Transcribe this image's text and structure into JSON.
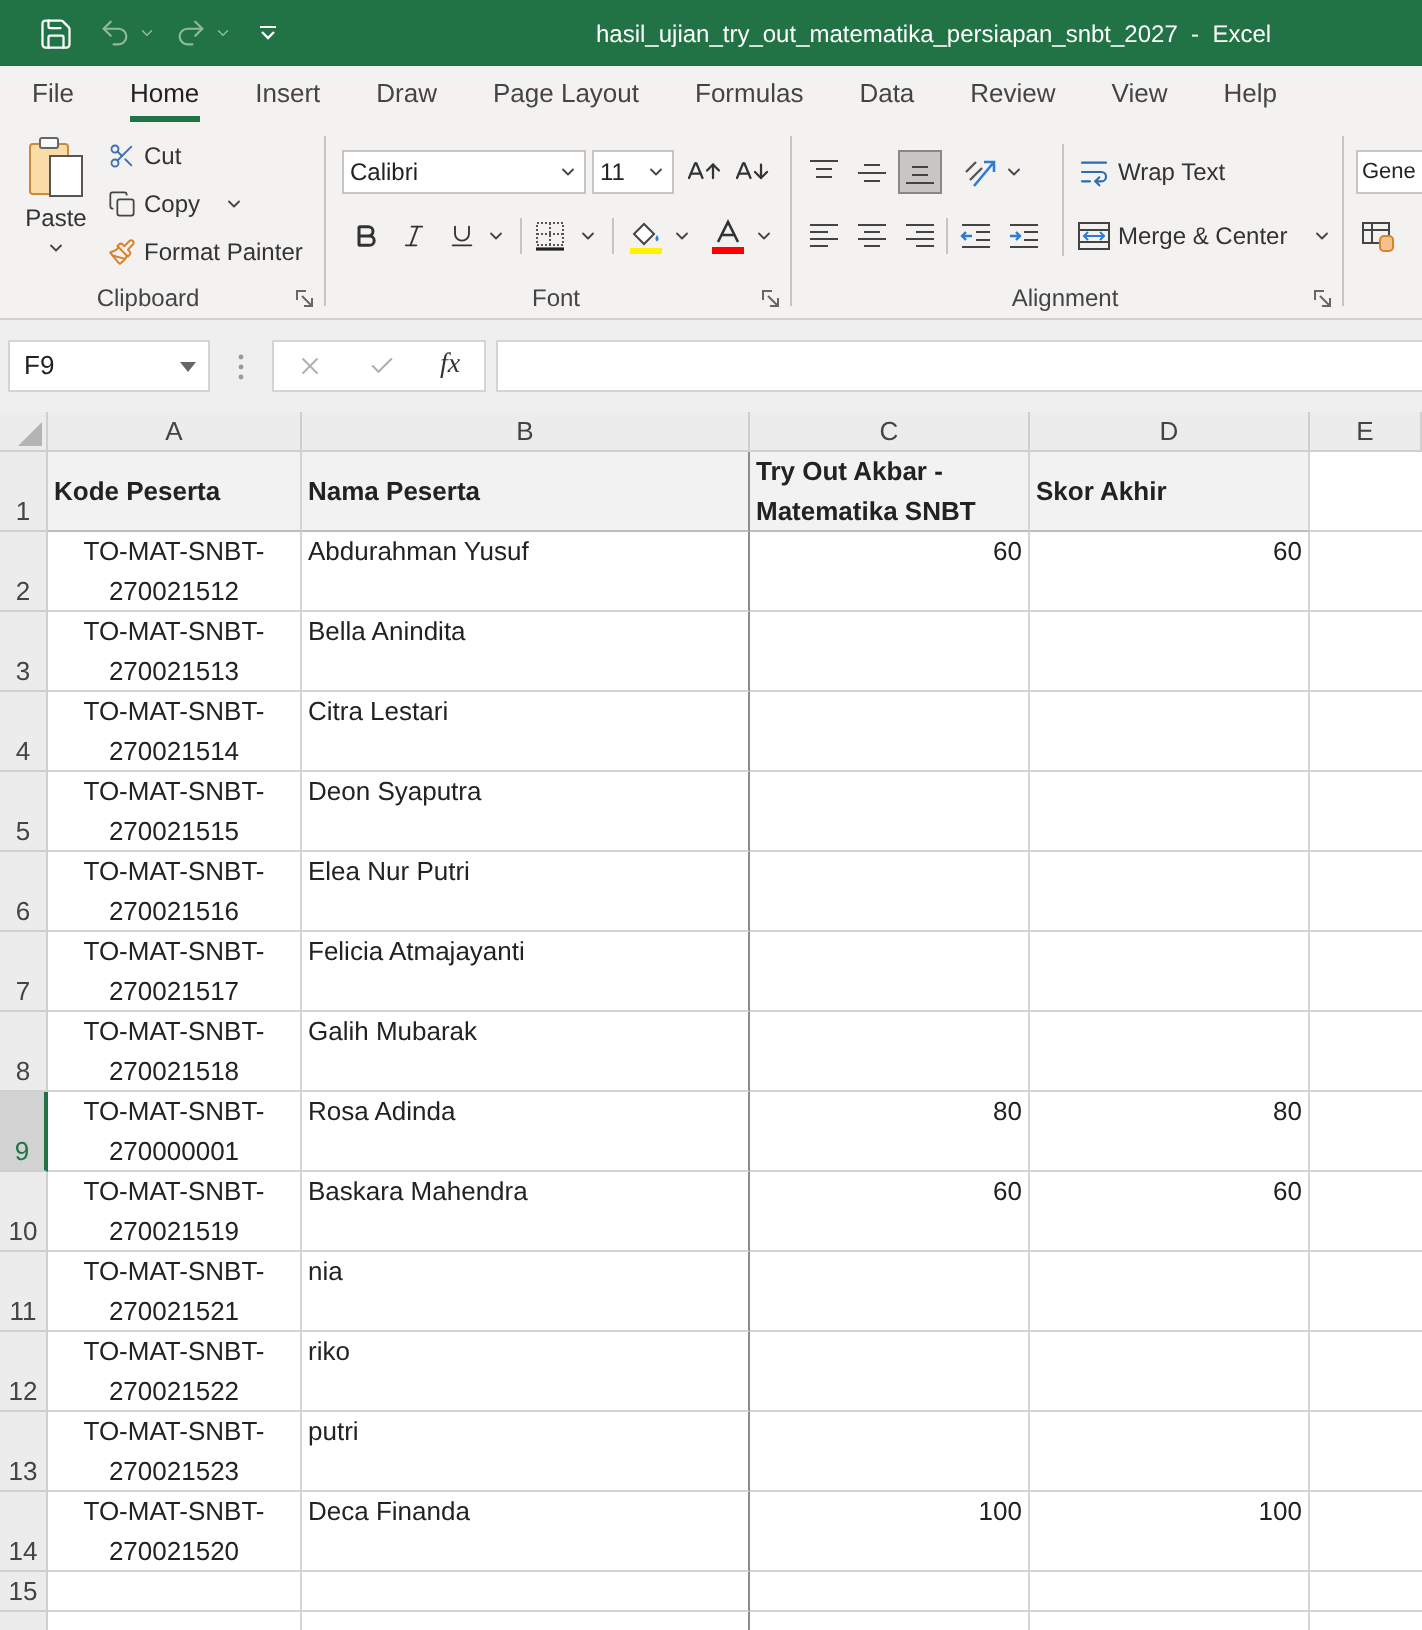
{
  "window": {
    "title": "hasil_ujian_try_out_matematika_persiapan_snbt_2027  -  Excel"
  },
  "menu_tabs": [
    {
      "label": "File",
      "selected": false
    },
    {
      "label": "Home",
      "selected": true
    },
    {
      "label": "Insert",
      "selected": false
    },
    {
      "label": "Draw",
      "selected": false
    },
    {
      "label": "Page Layout",
      "selected": false
    },
    {
      "label": "Formulas",
      "selected": false
    },
    {
      "label": "Data",
      "selected": false
    },
    {
      "label": "Review",
      "selected": false
    },
    {
      "label": "View",
      "selected": false
    },
    {
      "label": "Help",
      "selected": false
    }
  ],
  "ribbon": {
    "clipboard": {
      "paste": "Paste",
      "cut": "Cut",
      "copy": "Copy",
      "format_painter": "Format Painter",
      "label": "Clipboard"
    },
    "font": {
      "font_name": "Calibri",
      "font_size": "11",
      "label": "Font"
    },
    "alignment": {
      "vertical": [
        {
          "kind": "top",
          "selected": false
        },
        {
          "kind": "middle",
          "selected": false
        },
        {
          "kind": "bottom",
          "selected": true
        }
      ],
      "horizontal": [
        {
          "kind": "left",
          "selected": false
        },
        {
          "kind": "center",
          "selected": false
        },
        {
          "kind": "right",
          "selected": false
        }
      ],
      "wrap_text": "Wrap Text",
      "merge_center": "Merge & Center",
      "label": "Alignment"
    },
    "number": {
      "format": "Gene"
    }
  },
  "formula_bar": {
    "name_box": "F9",
    "function_button": "fx"
  },
  "sheet": {
    "columns": [
      {
        "label": "A",
        "selected": false
      },
      {
        "label": "B",
        "selected": false
      },
      {
        "label": "C",
        "selected": false
      },
      {
        "label": "D",
        "selected": false
      },
      {
        "label": "E",
        "selected": false
      }
    ],
    "header_row": {
      "number": "1",
      "selected": false,
      "cells": [
        "Kode Peserta",
        "Nama Peserta",
        "Try Out Akbar - Matematika SNBT",
        "Skor Akhir"
      ]
    },
    "rows": [
      {
        "number": "2",
        "selected": false,
        "kode_peserta": "TO-MAT-SNBT-270021512",
        "nama_peserta": "Abdurahman Yusuf",
        "try_out_akbar": "60",
        "skor_akhir": "60"
      },
      {
        "number": "3",
        "selected": false,
        "kode_peserta": "TO-MAT-SNBT-270021513",
        "nama_peserta": "Bella Anindita"
      },
      {
        "number": "4",
        "selected": false,
        "kode_peserta": "TO-MAT-SNBT-270021514",
        "nama_peserta": "Citra Lestari"
      },
      {
        "number": "5",
        "selected": false,
        "kode_peserta": "TO-MAT-SNBT-270021515",
        "nama_peserta": "Deon Syaputra"
      },
      {
        "number": "6",
        "selected": false,
        "kode_peserta": "TO-MAT-SNBT-270021516",
        "nama_peserta": "Elea Nur Putri"
      },
      {
        "number": "7",
        "selected": false,
        "kode_peserta": "TO-MAT-SNBT-270021517",
        "nama_peserta": "Felicia Atmajayanti"
      },
      {
        "number": "8",
        "selected": false,
        "kode_peserta": "TO-MAT-SNBT-270021518",
        "nama_peserta": "Galih Mubarak"
      },
      {
        "number": "9",
        "selected": true,
        "kode_peserta": "TO-MAT-SNBT-270000001",
        "nama_peserta": "Rosa Adinda",
        "try_out_akbar": "80",
        "skor_akhir": "80"
      },
      {
        "number": "10",
        "selected": false,
        "kode_peserta": "TO-MAT-SNBT-270021519",
        "nama_peserta": "Baskara Mahendra",
        "try_out_akbar": "60",
        "skor_akhir": "60"
      },
      {
        "number": "11",
        "selected": false,
        "kode_peserta": "TO-MAT-SNBT-270021521",
        "nama_peserta": "nia"
      },
      {
        "number": "12",
        "selected": false,
        "kode_peserta": "TO-MAT-SNBT-270021522",
        "nama_peserta": "riko"
      },
      {
        "number": "13",
        "selected": false,
        "kode_peserta": "TO-MAT-SNBT-270021523",
        "nama_peserta": "putri"
      },
      {
        "number": "14",
        "selected": false,
        "kode_peserta": "TO-MAT-SNBT-270021520",
        "nama_peserta": "Deca Finanda",
        "try_out_akbar": "100",
        "skor_akhir": "100"
      }
    ],
    "empty_rows": [
      {
        "number": "15",
        "selected": false
      },
      {
        "selected": false
      }
    ]
  }
}
